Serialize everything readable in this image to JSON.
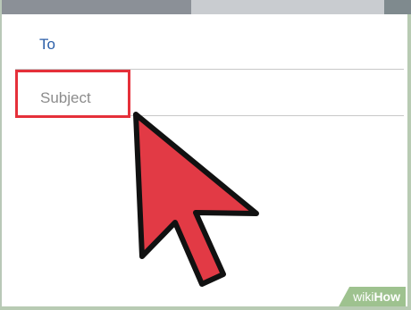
{
  "compose": {
    "to_label": "To",
    "subject_label": "Subject"
  },
  "colors": {
    "accent_blue": "#2a5ea8",
    "highlight_red": "#e5303a",
    "cursor_red": "#e23a45"
  },
  "cursor": {
    "icon": "arrow-pointer-icon"
  },
  "watermark": {
    "wiki": "wiki",
    "how": "How"
  }
}
